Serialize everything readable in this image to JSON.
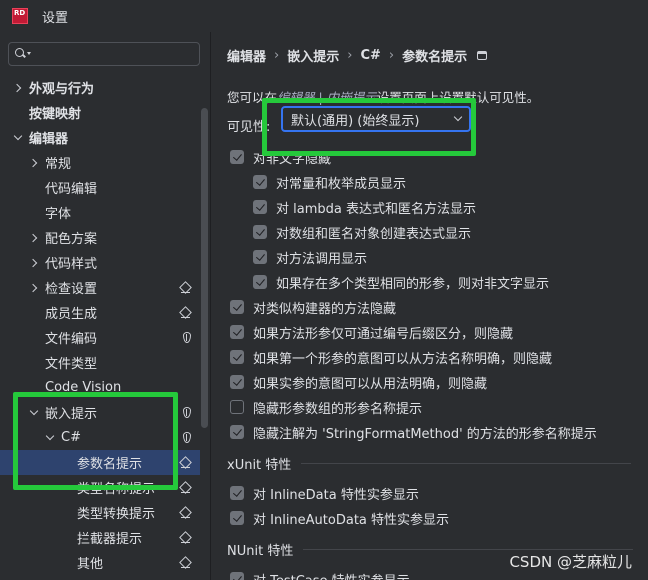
{
  "window": {
    "logo_text": "RD",
    "title": "设置"
  },
  "search": {
    "placeholder": ""
  },
  "sidebar": {
    "items": [
      {
        "label": "外观与行为",
        "bold": true
      },
      {
        "label": "按键映射",
        "bold": true
      },
      {
        "label": "编辑器",
        "bold": true
      },
      {
        "label": "常规"
      },
      {
        "label": "代码编辑"
      },
      {
        "label": "字体"
      },
      {
        "label": "配色方案"
      },
      {
        "label": "代码样式"
      },
      {
        "label": "检查设置"
      },
      {
        "label": "成员生成"
      },
      {
        "label": "文件编码"
      },
      {
        "label": "文件类型"
      },
      {
        "label": "Code Vision"
      },
      {
        "label": "嵌入提示"
      },
      {
        "label": "C#"
      },
      {
        "label": "参数名提示"
      },
      {
        "label": "类型名称提示"
      },
      {
        "label": "类型转换提示"
      },
      {
        "label": "拦截器提示"
      },
      {
        "label": "其他"
      }
    ]
  },
  "breadcrumb": {
    "items": [
      "编辑器",
      "嵌入提示",
      "C#",
      "参数名提示"
    ]
  },
  "main": {
    "intro_prefix": "您可以在",
    "intro_link": "编辑器 | 内嵌提示",
    "intro_suffix": "设置页面上设置默认可见性。",
    "visibility_label": "可见性:",
    "visibility_value": "默认(通用) (始终显示)",
    "checkboxes": [
      {
        "label": "对非文字隐藏",
        "checked": true
      },
      {
        "label": "对常量和枚举成员显示",
        "checked": true
      },
      {
        "label": "对 lambda 表达式和匿名方法显示",
        "checked": true
      },
      {
        "label": "对数组和匿名对象创建表达式显示",
        "checked": true
      },
      {
        "label": "对方法调用显示",
        "checked": true
      },
      {
        "label": "如果存在多个类型相同的形参，则对非文字显示",
        "checked": true
      },
      {
        "label": "对类似构建器的方法隐藏",
        "checked": true
      },
      {
        "label": "如果方法形参仅可通过编号后缀区分，则隐藏",
        "checked": true
      },
      {
        "label": "如果第一个形参的意图可以从方法名称明确，则隐藏",
        "checked": true
      },
      {
        "label": "如果实参的意图可以从用法明确，则隐藏",
        "checked": true
      },
      {
        "label": "隐藏形参数组的形参名称提示",
        "checked": false
      },
      {
        "label": "隐藏注解为 'StringFormatMethod' 的方法的形参名称提示",
        "checked": true
      }
    ],
    "xunit_title": "xUnit 特性",
    "xunit_items": [
      {
        "label": "对 InlineData 特性实参显示",
        "checked": true
      },
      {
        "label": "对 InlineAutoData 特性实参显示",
        "checked": true
      }
    ],
    "nunit_title": "NUnit 特性",
    "nunit_items": [
      {
        "label": "对 TestCase 特性实参显示",
        "checked": true
      }
    ]
  },
  "watermark": "CSDN @芝麻粒儿",
  "colors": {
    "highlight": "#25c93b",
    "selection": "#2e436e",
    "accent": "#3574f0"
  }
}
